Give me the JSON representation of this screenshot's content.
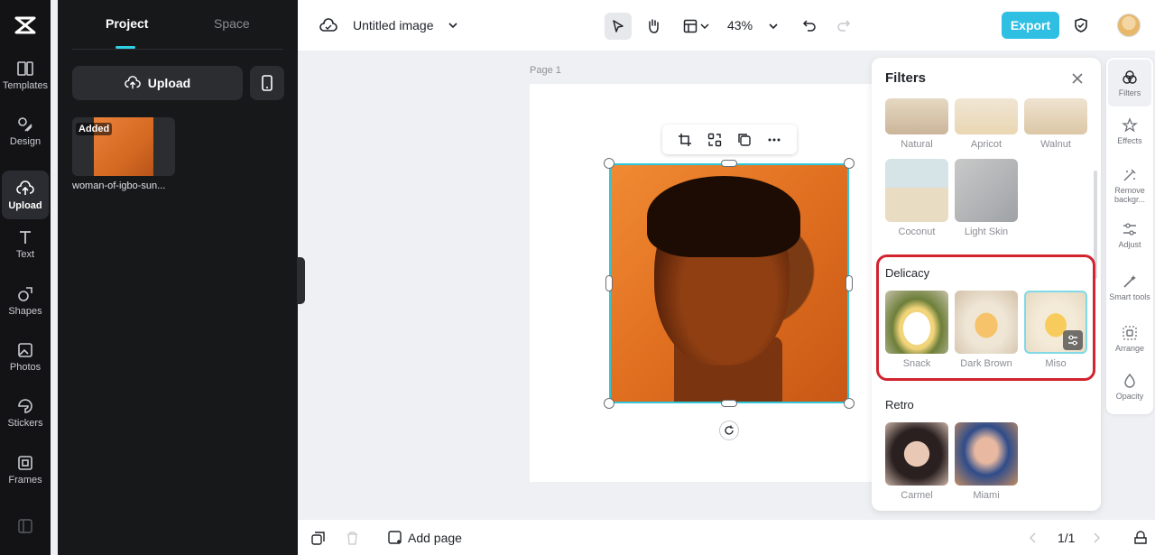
{
  "left_rail": {
    "items": [
      {
        "label": "Templates",
        "icon": "templates-icon"
      },
      {
        "label": "Design",
        "icon": "design-icon"
      },
      {
        "label": "Upload",
        "icon": "upload-cloud-icon",
        "active": true
      },
      {
        "label": "Text",
        "icon": "text-icon"
      },
      {
        "label": "Shapes",
        "icon": "shapes-icon"
      },
      {
        "label": "Photos",
        "icon": "photos-icon"
      },
      {
        "label": "Stickers",
        "icon": "stickers-icon"
      },
      {
        "label": "Frames",
        "icon": "frames-icon"
      }
    ]
  },
  "panel": {
    "tabs": [
      "Project",
      "Space"
    ],
    "active_tab": "Project",
    "upload_label": "Upload",
    "asset": {
      "badge": "Added",
      "name": "woman-of-igbo-sun..."
    }
  },
  "topbar": {
    "title": "Untitled image",
    "zoom": "43%",
    "export_label": "Export"
  },
  "canvas": {
    "page_label": "Page 1"
  },
  "filters": {
    "title": "Filters",
    "top_row": [
      "Natural",
      "Apricot",
      "Walnut"
    ],
    "second_row": [
      "Coconut",
      "Light Skin"
    ],
    "sections": [
      {
        "title": "Delicacy",
        "items": [
          "Snack",
          "Dark Brown",
          "Miso"
        ],
        "selected": "Miso"
      },
      {
        "title": "Retro",
        "items": [
          "Carmel",
          "Miami"
        ]
      }
    ]
  },
  "right_rail": {
    "items": [
      {
        "label": "Filters",
        "icon": "filters-icon",
        "active": true
      },
      {
        "label": "Effects",
        "icon": "effects-icon"
      },
      {
        "label": "Remove backgr...",
        "icon": "remove-background-icon"
      },
      {
        "label": "Adjust",
        "icon": "adjust-icon"
      },
      {
        "label": "Smart tools",
        "icon": "smart-tools-icon"
      },
      {
        "label": "Arrange",
        "icon": "arrange-icon"
      },
      {
        "label": "Opacity",
        "icon": "opacity-icon"
      }
    ]
  },
  "bottombar": {
    "add_page_label": "Add page",
    "pager": "1/1"
  },
  "colors": {
    "accent": "#2fbfe3",
    "highlight": "#d2232f",
    "rail_bg": "#131315"
  }
}
